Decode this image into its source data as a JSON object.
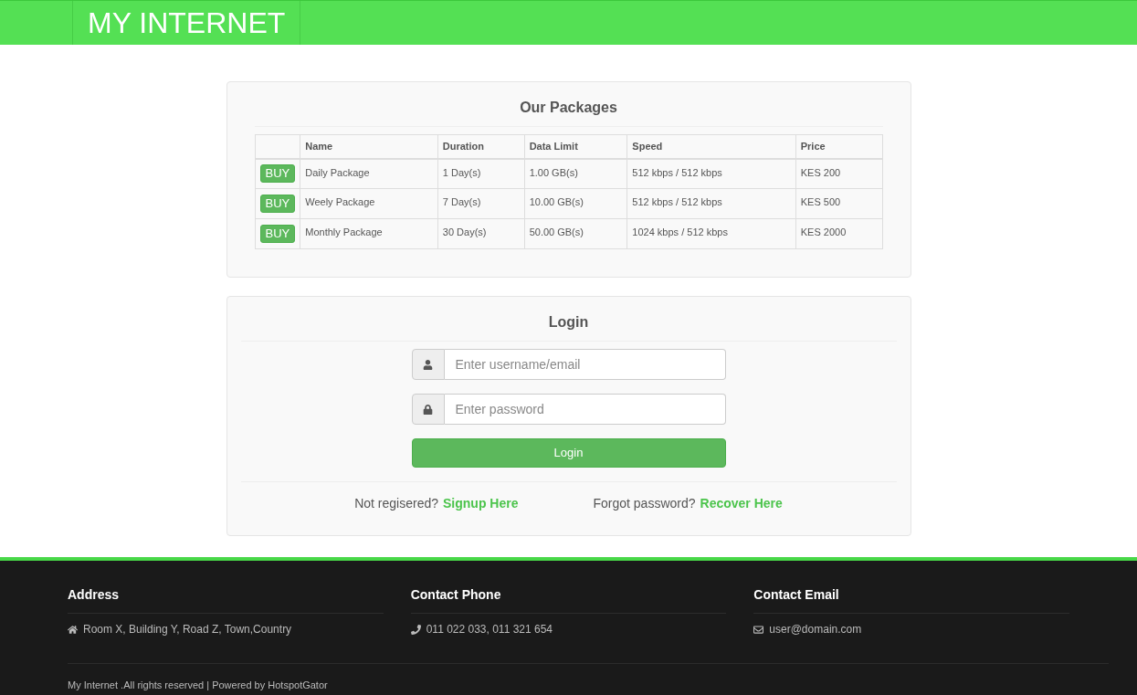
{
  "header": {
    "brand": "MY INTERNET"
  },
  "packages": {
    "title": "Our Packages",
    "columns": [
      "Name",
      "Duration",
      "Data Limit",
      "Speed",
      "Price"
    ],
    "rows": [
      {
        "buy": "BUY",
        "cells": [
          "Daily Package",
          "1 Day(s)",
          "1.00 GB(s)",
          "512 kbps / 512 kbps",
          "KES 200"
        ]
      },
      {
        "buy": "BUY",
        "cells": [
          "Weely Package",
          "7 Day(s)",
          "10.00 GB(s)",
          "512 kbps / 512 kbps",
          "KES 500"
        ]
      },
      {
        "buy": "BUY",
        "cells": [
          "Monthly Package",
          "30 Day(s)",
          "50.00 GB(s)",
          "1024 kbps / 512 kbps",
          "KES 2000"
        ]
      }
    ]
  },
  "login": {
    "title": "Login",
    "fields": [
      {
        "kind": "user",
        "placeholder": "Enter username/email"
      },
      {
        "kind": "lock",
        "placeholder": "Enter password"
      }
    ],
    "button": "Login",
    "links": [
      {
        "text": "Not regisered?",
        "link": "Signup Here"
      },
      {
        "text": "Forgot password?",
        "link": "Recover Here"
      }
    ]
  },
  "footer": {
    "columns": [
      {
        "kind": "home",
        "heading": "Address",
        "text": "Room X, Building Y, Road Z, Town,Country"
      },
      {
        "kind": "phone",
        "heading": "Contact Phone",
        "text": "011 022 033, 011 321 654"
      },
      {
        "kind": "mail",
        "heading": "Contact Email",
        "text": "user@domain.com"
      }
    ],
    "copyright": "My Internet .All rights reserved | Powered by HotspotGator"
  }
}
